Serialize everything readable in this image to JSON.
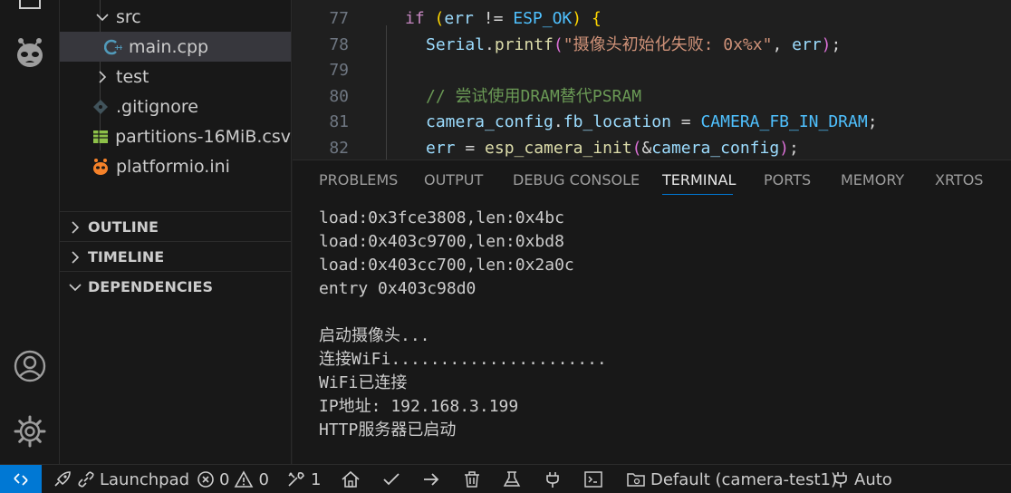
{
  "sidebar": {
    "items": [
      {
        "label": "src",
        "type": "folder",
        "expanded": true
      },
      {
        "label": "main.cpp",
        "type": "file",
        "icon": "cpp-icon",
        "selected": true
      },
      {
        "label": "test",
        "type": "folder",
        "expanded": false
      },
      {
        "label": ".gitignore",
        "type": "file",
        "icon": "gitignore-icon"
      },
      {
        "label": "partitions-16MiB.csv",
        "type": "file",
        "icon": "csv-icon"
      },
      {
        "label": "platformio.ini",
        "type": "file",
        "icon": "platformio-icon"
      }
    ],
    "sections": [
      {
        "label": "OUTLINE",
        "expanded": false
      },
      {
        "label": "TIMELINE",
        "expanded": false
      },
      {
        "label": "DEPENDENCIES",
        "expanded": true
      }
    ]
  },
  "editor": {
    "line_numbers": [
      "77",
      "78",
      "79",
      "80",
      "81",
      "82"
    ],
    "code": {
      "l77_kw": "if",
      "l77_var": "err",
      "l77_op": " != ",
      "l77_const": "ESP_OK",
      "l78_obj": "Serial",
      "l78_fn": "printf",
      "l78_str": "\"摄像头初始化失败: 0x%x\"",
      "l78_var": "err",
      "l80_comment": "// 尝试使用DRAM替代PSRAM",
      "l81_obj": "camera_config",
      "l81_prop": "fb_location",
      "l81_const": "CAMERA_FB_IN_DRAM",
      "l82_var": "err",
      "l82_fn": "esp_camera_init",
      "l82_arg": "camera_config"
    }
  },
  "panel": {
    "tabs": [
      "PROBLEMS",
      "OUTPUT",
      "DEBUG CONSOLE",
      "TERMINAL",
      "PORTS",
      "MEMORY",
      "XRTOS"
    ],
    "active_tab": "TERMINAL",
    "terminal_lines": [
      "load:0x3fce3808,len:0x4bc",
      "load:0x403c9700,len:0xbd8",
      "load:0x403cc700,len:0x2a0c",
      "entry 0x403c98d0",
      "",
      "启动摄像头...",
      "连接WiFi......................",
      "WiFi已连接",
      "IP地址: 192.168.3.199",
      "HTTP服务器已启动"
    ]
  },
  "statusbar": {
    "launchpad": "Launchpad",
    "errors": "0",
    "warnings": "0",
    "tools_count": "1",
    "env": "Default (camera-test1)",
    "port": "Auto"
  },
  "colors": {
    "accent": "#0078d4",
    "background": "#1e1e1e",
    "sidebar": "#181818"
  }
}
